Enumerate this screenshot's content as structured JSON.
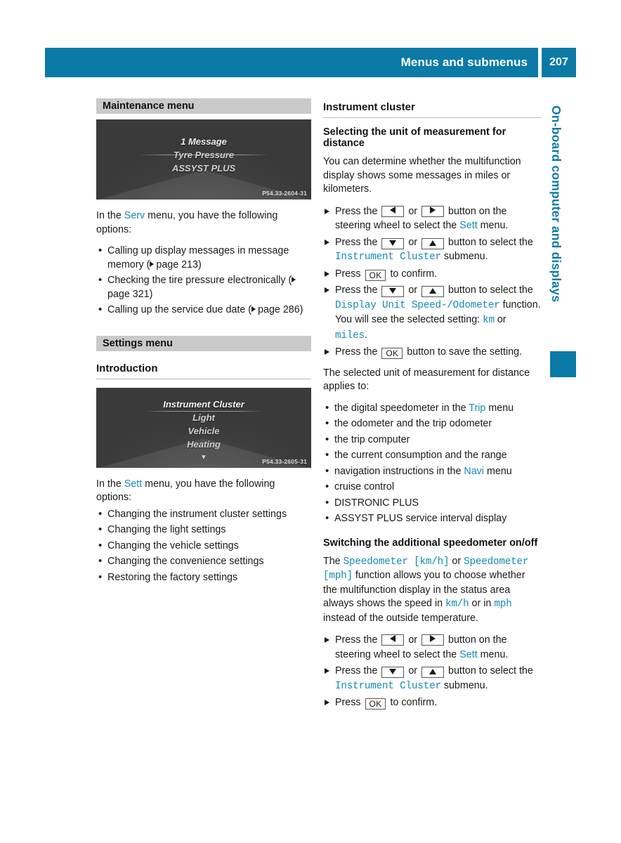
{
  "header": {
    "title": "Menus and submenus",
    "page_number": "207",
    "band_color": "#0b7aa6"
  },
  "side_tab": {
    "label": "On-board computer and displays",
    "color": "#0b7aa6"
  },
  "left_column": {
    "maintenance": {
      "bar_label": "Maintenance menu",
      "figure": {
        "items": [
          "1 Message",
          "Tyre Pressure",
          "ASSYST PLUS"
        ],
        "code": "P54.33-2604-31"
      },
      "intro_pre": "In the ",
      "intro_term": "Serv",
      "intro_post": " menu, you have the following options:",
      "bullets": [
        {
          "text": "Calling up display messages in message memory (",
          "ref": "page 213",
          "tail": ")"
        },
        {
          "text": "Checking the tire pressure electronically (",
          "ref": "page 321",
          "tail": ")"
        },
        {
          "text": "Calling up the service due date (",
          "ref": "page 286",
          "tail": ")"
        }
      ]
    },
    "settings": {
      "bar_label": "Settings menu",
      "sub_head": "Introduction",
      "figure": {
        "items": [
          "Instrument Cluster",
          "Light",
          "Vehicle",
          "Heating"
        ],
        "more_glyph": "▼",
        "code": "P54.33-2605-31"
      },
      "intro_pre": "In the ",
      "intro_term": "Sett",
      "intro_post": " menu, you have the following options:",
      "bullets": [
        "Changing the instrument cluster settings",
        "Changing the light settings",
        "Changing the vehicle settings",
        "Changing the convenience settings",
        "Restoring the factory settings"
      ]
    }
  },
  "right_column": {
    "heading": "Instrument cluster",
    "section1": {
      "sub_head": "Selecting the unit of measurement for distance",
      "intro": "You can determine whether the multifunction display shows some messages in miles or kilometers.",
      "steps": [
        {
          "parts": [
            "Press the ",
            " or ",
            " button on the steering wheel to select the ",
            " menu."
          ],
          "keys": [
            "left-arrow",
            "right-arrow"
          ],
          "term": "Sett"
        },
        {
          "parts": [
            "Press the ",
            " or ",
            " button to select the ",
            " submenu."
          ],
          "keys": [
            "down-arrow",
            "up-arrow"
          ],
          "term": "Instrument Cluster"
        },
        {
          "parts": [
            "Press ",
            " to confirm."
          ],
          "keys": [
            "OK"
          ]
        },
        {
          "parts": [
            "Press the ",
            " or ",
            " button to select the ",
            " function."
          ],
          "keys": [
            "down-arrow",
            "up-arrow"
          ],
          "term": "Display Unit Speed-/Odometer",
          "note_pre": "You will see the selected setting: ",
          "note_term1": "km",
          "note_mid": " or ",
          "note_term2": "miles",
          "note_post": "."
        },
        {
          "parts": [
            "Press the ",
            " button to save the setting."
          ],
          "keys": [
            "OK"
          ]
        }
      ],
      "applies_intro": "The selected unit of measurement for distance applies to:",
      "applies": [
        {
          "pre": "the digital speedometer in the ",
          "term": "Trip",
          "post": " menu"
        },
        {
          "pre": "the odometer and the trip odometer",
          "term": "",
          "post": ""
        },
        {
          "pre": "the trip computer",
          "term": "",
          "post": ""
        },
        {
          "pre": "the current consumption and the range",
          "term": "",
          "post": ""
        },
        {
          "pre": "navigation instructions in the ",
          "term": "Navi",
          "post": " menu"
        },
        {
          "pre": "cruise control",
          "term": "",
          "post": ""
        },
        {
          "pre": "DISTRONIC PLUS",
          "term": "",
          "post": ""
        },
        {
          "pre": "ASSYST PLUS service interval display",
          "term": "",
          "post": ""
        }
      ]
    },
    "section2": {
      "sub_head": "Switching the additional speedometer on/off",
      "intro_a": "The ",
      "intro_term1": "Speedometer [km/h]",
      "intro_b": " or ",
      "intro_term2": "Speedometer [mph]",
      "intro_c": " function allows you to choose whether the multifunction display in the status area always shows the speed in ",
      "intro_term3": "km/h",
      "intro_d": " or in ",
      "intro_term4": "mph",
      "intro_e": " instead of the outside temperature.",
      "steps": [
        {
          "parts": [
            "Press the ",
            " or ",
            " button on the steering wheel to select the ",
            " menu."
          ],
          "keys": [
            "left-arrow",
            "right-arrow"
          ],
          "term": "Sett"
        },
        {
          "parts": [
            "Press the ",
            " or ",
            " button to select the ",
            " submenu."
          ],
          "keys": [
            "down-arrow",
            "up-arrow"
          ],
          "term": "Instrument Cluster"
        },
        {
          "parts": [
            "Press ",
            " to confirm."
          ],
          "keys": [
            "OK"
          ]
        }
      ]
    }
  }
}
